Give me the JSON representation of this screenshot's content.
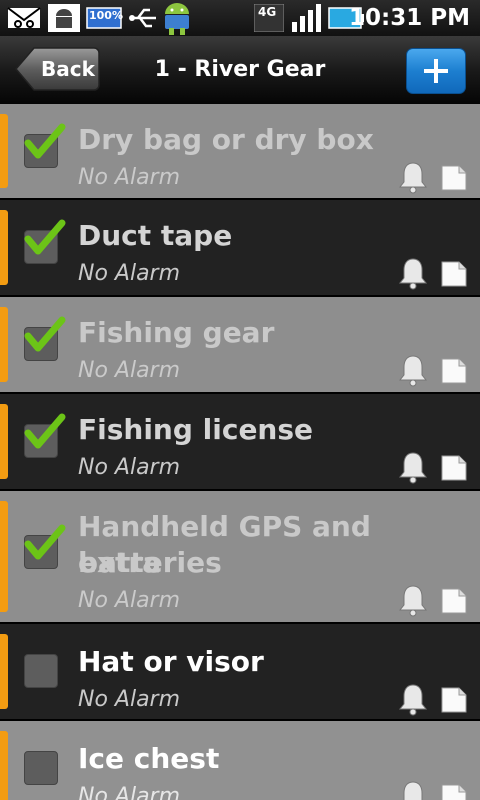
{
  "status_bar": {
    "time": "10:31 PM",
    "battery_label": "100%",
    "network_label": "4G"
  },
  "header": {
    "back_label": "Back",
    "title": "1 - River Gear",
    "add_icon": "plus-icon"
  },
  "items": [
    {
      "title_line1": "Dry bag or dry box",
      "title_line2": "",
      "subtitle": "No Alarm",
      "checked": true
    },
    {
      "title_line1": "Duct tape",
      "title_line2": "",
      "subtitle": "No Alarm",
      "checked": true
    },
    {
      "title_line1": "Fishing gear",
      "title_line2": "",
      "subtitle": "No Alarm",
      "checked": true
    },
    {
      "title_line1": "Fishing license",
      "title_line2": "",
      "subtitle": "No Alarm",
      "checked": true
    },
    {
      "title_line1": "Handheld GPS and extra",
      "title_line2": "batteries",
      "subtitle": "No Alarm",
      "checked": true
    },
    {
      "title_line1": "Hat or visor",
      "title_line2": "",
      "subtitle": "No Alarm",
      "checked": false
    },
    {
      "title_line1": "Ice chest",
      "title_line2": "",
      "subtitle": "No Alarm",
      "checked": false
    }
  ],
  "colors": {
    "accent": "#f39c12",
    "check": "#6cc417",
    "add_button": "#1d7fd0"
  }
}
